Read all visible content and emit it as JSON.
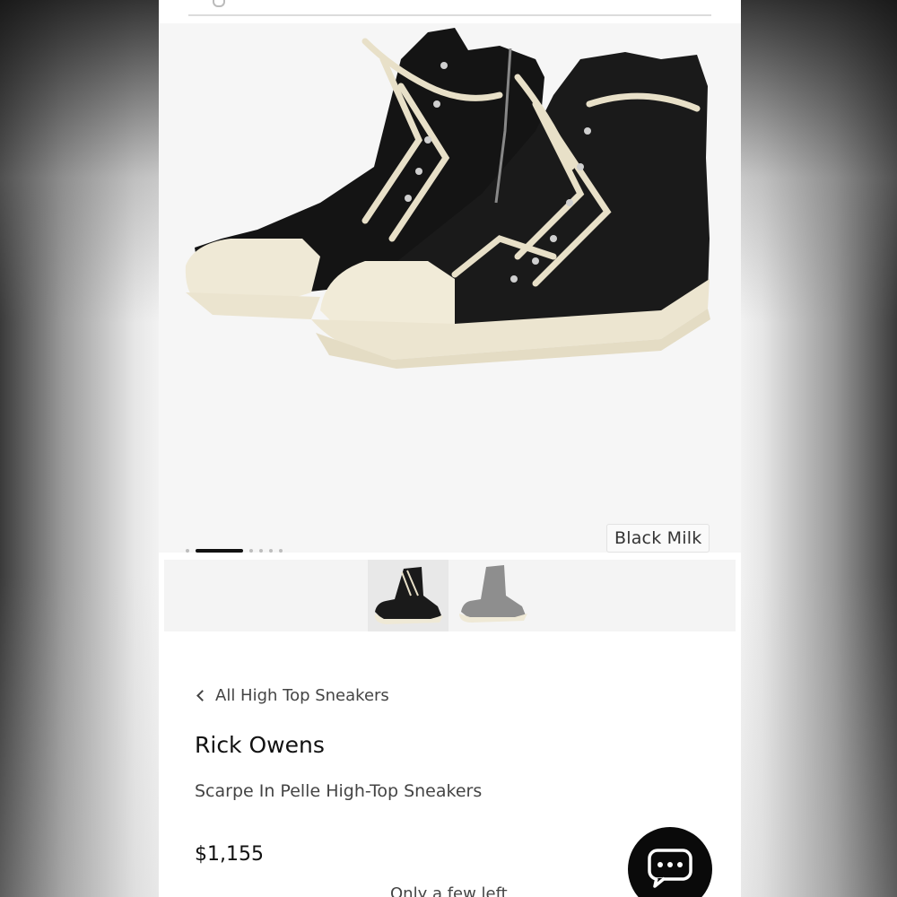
{
  "hero": {
    "color_label": "Black Milk",
    "image_alt": "Black leather high-top sneakers with milk-white rubber soles and laces",
    "carousel": {
      "total": 7,
      "active": 1
    }
  },
  "thumbnails": [
    {
      "name": "Black Milk"
    },
    {
      "name": "Grey"
    }
  ],
  "breadcrumb": {
    "back_label": "All High Top Sneakers"
  },
  "product": {
    "brand": "Rick Owens",
    "name": "Scarpe In Pelle High-Top Sneakers",
    "price": "$1,155",
    "stock_note": "Only a few left"
  },
  "colors": {
    "accent": "#111111",
    "sole": "#efe9d6",
    "leather": "#1a1a1a"
  },
  "icons": {
    "chat": "chat-bubble-icon",
    "back": "chevron-left-icon"
  }
}
